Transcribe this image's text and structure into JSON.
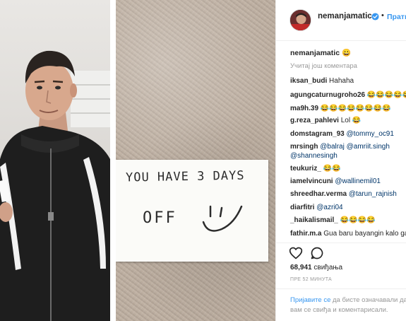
{
  "header": {
    "username": "nemanjamatic",
    "separator": "•",
    "follow_label": "Прати"
  },
  "post": {
    "note_line1": "YOU HAVE 3 DAYS",
    "note_line2": "OFF"
  },
  "caption": {
    "username": "nemanjamatic",
    "text": "😀"
  },
  "load_more": "Учитај још коментара",
  "comments": [
    {
      "user": "iksan_budi",
      "text": "Hahaha",
      "mention": ""
    },
    {
      "user": "agungcaturnugroho26",
      "text": "😂😂😂😂😂",
      "mention": ""
    },
    {
      "user": "ma9h.39",
      "text": "😂😂😂😂😂😂😂😂",
      "mention": ""
    },
    {
      "user": "g.reza_pahlevi",
      "text": "Lol 😂",
      "mention": ""
    },
    {
      "user": "domstagram_93",
      "text": "",
      "mention": "@tommy_oc91"
    },
    {
      "user": "mrsingh",
      "text": "",
      "mention": "@balraj @amriit.singh"
    },
    {
      "user": "",
      "text": "",
      "mention": "@shannesingh"
    },
    {
      "user": "teukuriz_",
      "text": "😂😂",
      "mention": ""
    },
    {
      "user": "iamelvincuni",
      "text": "",
      "mention": "@wallinemil01"
    },
    {
      "user": "shreedhar.verma",
      "text": "",
      "mention": "@tarun_rajnish"
    },
    {
      "user": "diarfitri",
      "text": "",
      "mention": "@azri04"
    },
    {
      "user": "_haikalismail_",
      "text": "😂😂😂😂",
      "mention": ""
    },
    {
      "user": "fathir.m.a",
      "text": "Gua baru bayangin kalo ga",
      "mention": ""
    }
  ],
  "likes": {
    "count": "68,941",
    "label": "свиђања"
  },
  "time_ago": "ПРЕ 52 МИНУТА",
  "login": {
    "link": "Пријавите се",
    "text1": " да бисте означавали да",
    "text2": "вам се свиђа и коментарисали."
  },
  "colors": {
    "link_blue": "#3897f0",
    "mention_blue": "#003569",
    "muted_gray": "#999999",
    "text_dark": "#262626"
  },
  "icons": {
    "verified": "verified-badge-icon",
    "like": "heart-icon",
    "comment": "comment-bubble-icon"
  }
}
